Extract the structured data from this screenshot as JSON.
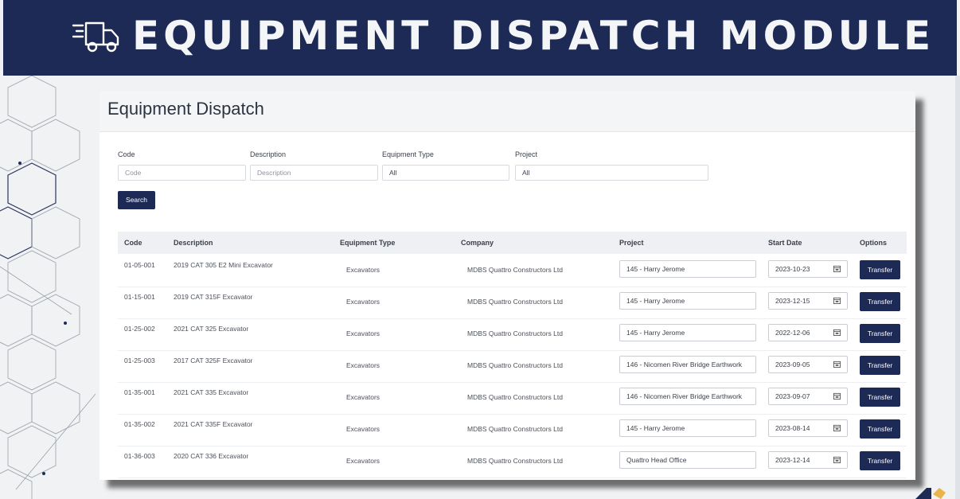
{
  "banner": {
    "title": "EQUIPMENT DISPATCH MODULE",
    "icon": "delivery-truck-icon"
  },
  "panel": {
    "title": "Equipment Dispatch"
  },
  "filters": {
    "code": {
      "label": "Code",
      "placeholder": "Code"
    },
    "description": {
      "label": "Description",
      "placeholder": "Description"
    },
    "equipment_type": {
      "label": "Equipment Type",
      "value": "All"
    },
    "project": {
      "label": "Project",
      "value": "All"
    },
    "search_label": "Search"
  },
  "table": {
    "headers": {
      "code": "Code",
      "description": "Description",
      "equipment_type": "Equipment Type",
      "company": "Company",
      "project": "Project",
      "start_date": "Start Date",
      "options": "Options"
    },
    "rows": [
      {
        "code": "01-05-001",
        "description": "2019 CAT 305 E2 Mini Excavator",
        "equipment_type": "Excavators",
        "company": "MDBS Quattro Constructors Ltd",
        "project": "145 - Harry Jerome",
        "start_date": "2023-10-23",
        "action": "Transfer"
      },
      {
        "code": "01-15-001",
        "description": "2019 CAT 315F Excavator",
        "equipment_type": "Excavators",
        "company": "MDBS Quattro Constructors Ltd",
        "project": "145 - Harry Jerome",
        "start_date": "2023-12-15",
        "action": "Transfer"
      },
      {
        "code": "01-25-002",
        "description": "2021 CAT 325 Excavator",
        "equipment_type": "Excavators",
        "company": "MDBS Quattro Constructors Ltd",
        "project": "145 - Harry Jerome",
        "start_date": "2022-12-06",
        "action": "Transfer"
      },
      {
        "code": "01-25-003",
        "description": "2017 CAT 325F Excavator",
        "equipment_type": "Excavators",
        "company": "MDBS Quattro Constructors Ltd",
        "project": "146 - Nicomen River Bridge Earthwork",
        "start_date": "2023-09-05",
        "action": "Transfer"
      },
      {
        "code": "01-35-001",
        "description": "2021 CAT 335 Excavator",
        "equipment_type": "Excavators",
        "company": "MDBS Quattro Constructors Ltd",
        "project": "146 - Nicomen River Bridge Earthwork",
        "start_date": "2023-09-07",
        "action": "Transfer"
      },
      {
        "code": "01-35-002",
        "description": "2021 CAT 335F Excavator",
        "equipment_type": "Excavators",
        "company": "MDBS Quattro Constructors Ltd",
        "project": "145 - Harry Jerome",
        "start_date": "2023-08-14",
        "action": "Transfer"
      },
      {
        "code": "01-36-003",
        "description": "2020 CAT 336 Excavator",
        "equipment_type": "Excavators",
        "company": "MDBS Quattro Constructors Ltd",
        "project": "Quattro Head Office",
        "start_date": "2023-12-14",
        "action": "Transfer"
      }
    ]
  },
  "colors": {
    "navy": "#1c2a55",
    "page_bg": "#f1f2f4"
  }
}
